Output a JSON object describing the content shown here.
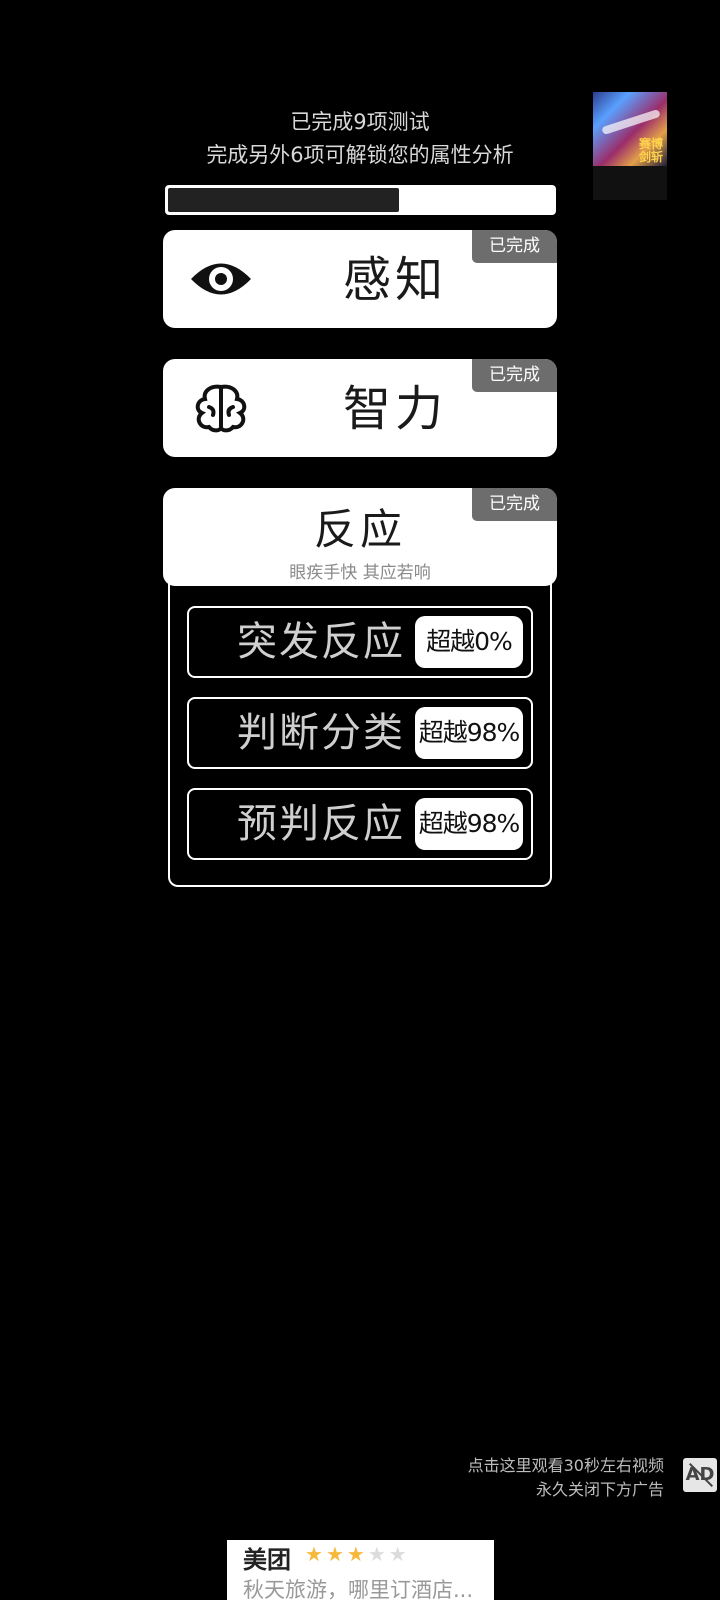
{
  "status": {
    "line1": "已完成9项测试",
    "line2": "完成另外6项可解锁您的属性分析",
    "progress": 0.6
  },
  "cards": [
    {
      "title": "感知",
      "badge": "已完成",
      "icon": "eye-icon"
    },
    {
      "title": "智力",
      "badge": "已完成",
      "icon": "brain-icon"
    },
    {
      "title": "反应",
      "badge": "已完成",
      "subtitle": "眼疾手快 其应若响"
    }
  ],
  "reaction_tests": [
    {
      "label": "突发反应",
      "score": "超越0%"
    },
    {
      "label": "判断分类",
      "score": "超越98%"
    },
    {
      "label": "预判反应",
      "score": "超越98%"
    }
  ],
  "thumbnail": {
    "text": "赛博剑斩"
  },
  "ad_prompt": {
    "line1": "点击这里观看30秒左右视频",
    "line2": "永久关闭下方广告",
    "icon_label": "AD"
  },
  "banner_ad": {
    "brand": "美团",
    "rating": 3,
    "rating_max": 5,
    "text": "秋天旅游，哪里订酒店..."
  },
  "colors": {
    "background": "#000000",
    "card": "#ffffff",
    "badge": "#6d6d6d",
    "star": "#f6b93b"
  }
}
